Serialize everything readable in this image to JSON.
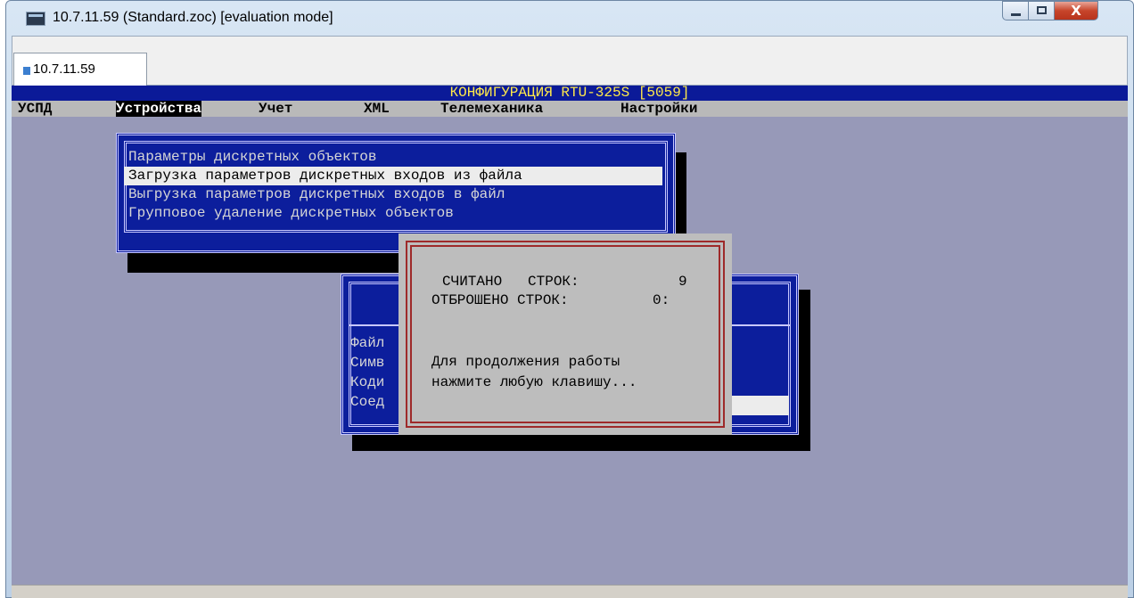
{
  "window": {
    "title": "10.7.11.59 (Standard.zoc) [evaluation mode]",
    "close_glyph": "X"
  },
  "tab": {
    "label": "10.7.11.59"
  },
  "terminal": {
    "title": "КОНФИГУРАЦИЯ RTU-325S [5059]",
    "menu": [
      "УСПД",
      "Устройства",
      "Учет",
      "XML",
      "Телемеханика",
      "Настройки"
    ],
    "active_menu": "Устройства",
    "dropdown": [
      "Параметры дискретных объектов",
      "Загрузка параметров дискретных входов из файла",
      "Выгрузка параметров дискретных входов в файл",
      "Групповое удаление дискретных объектов"
    ],
    "selected_dropdown_item": "Загрузка параметров дискретных входов из файла",
    "back_dialog_rows": [
      "Файл",
      "Симв",
      "Коди",
      "Соед"
    ],
    "message": {
      "read_label": "СЧИТАНО   СТРОК:",
      "read_value": "9",
      "dropped_label": "ОТБРОШЕНО СТРОК:",
      "dropped_value": "0:",
      "prompt_line1": "Для продолжения работы",
      "prompt_line2": "нажмите любую клавишу..."
    }
  },
  "colors": {
    "terminal_background": "#9799b8",
    "panel_blue": "#0c1e9c",
    "title_yellow": "#ffe94a",
    "message_frame_red": "#9e2a2a"
  }
}
